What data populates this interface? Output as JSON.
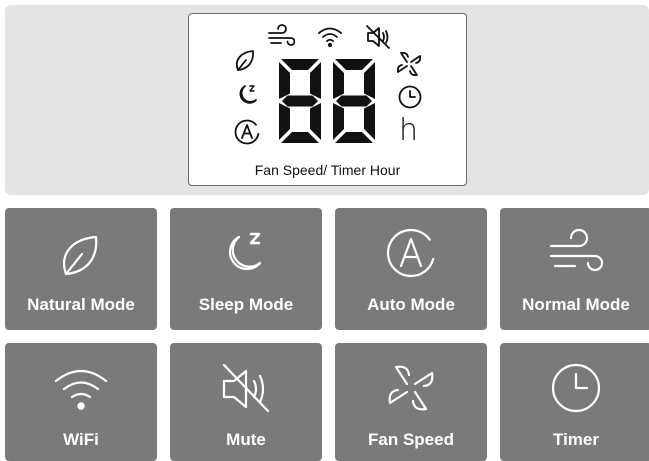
{
  "display": {
    "digits": "88",
    "unit": "h",
    "label": "Fan Speed/ Timer Hour",
    "indicator_icons": [
      "wind-icon",
      "wifi-icon",
      "mute-icon",
      "leaf-icon",
      "sleep-icon",
      "auto-icon",
      "fan-icon",
      "clock-icon"
    ]
  },
  "buttons": [
    {
      "label": "Natural Mode",
      "icon": "leaf-icon"
    },
    {
      "label": "Sleep Mode",
      "icon": "moon-icon"
    },
    {
      "label": "Auto Mode",
      "icon": "auto-icon"
    },
    {
      "label": "Normal Mode",
      "icon": "wind-icon"
    },
    {
      "label": "WiFi",
      "icon": "wifi-icon"
    },
    {
      "label": "Mute",
      "icon": "mute-icon"
    },
    {
      "label": "Fan Speed",
      "icon": "fan-icon"
    },
    {
      "label": "Timer",
      "icon": "clock-icon"
    }
  ],
  "colors": {
    "button_bg": "#7a7a7a",
    "panel_bg": "#e4e4e4",
    "segment": "#111111"
  }
}
